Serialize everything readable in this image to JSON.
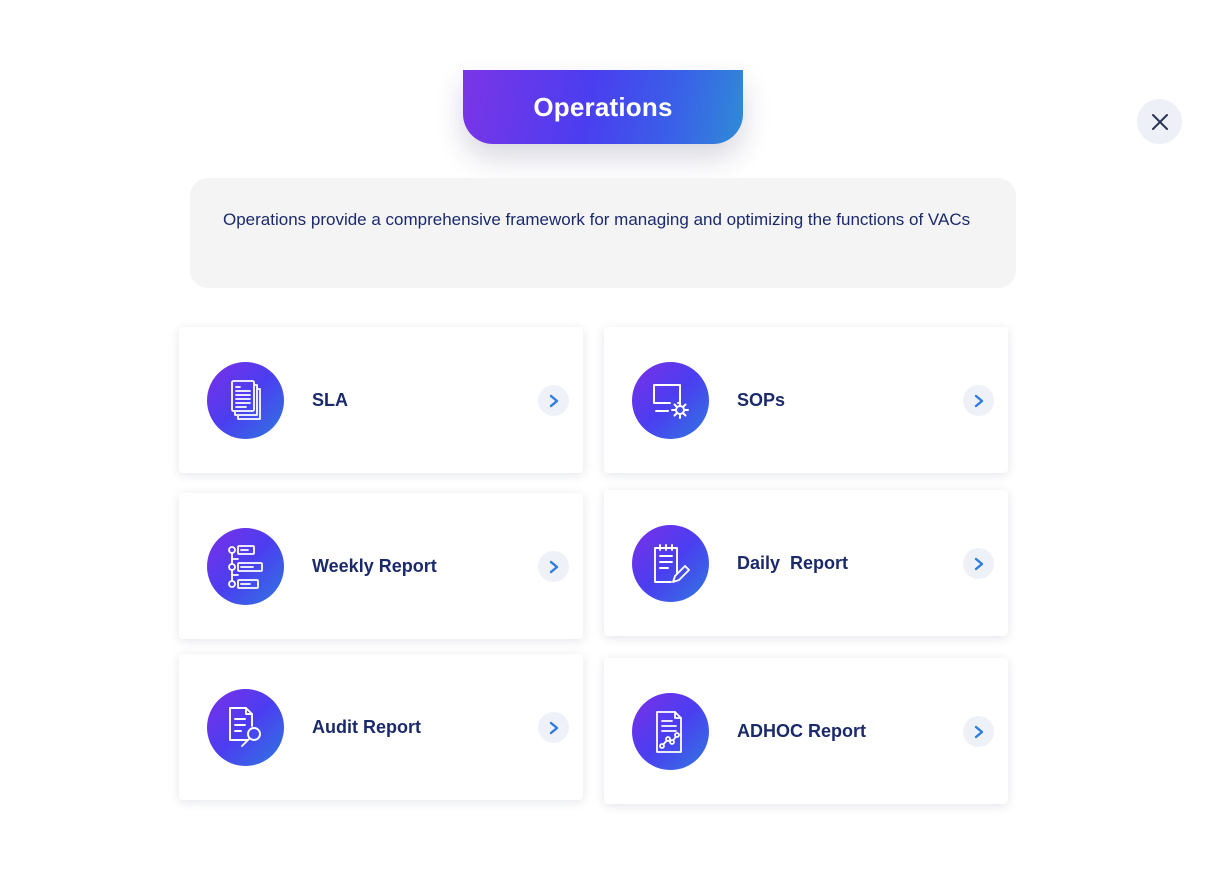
{
  "header": {
    "title": "Operations"
  },
  "description": "Operations provide a comprehensive framework for managing and optimizing the functions of VACs",
  "colors": {
    "accent_start": "#7b35e6",
    "accent_end": "#2f8bd6",
    "text": "#1b2a6b"
  },
  "cards": [
    {
      "label": "SLA",
      "icon": "documents-stack-icon"
    },
    {
      "label": "SOPs",
      "icon": "monitor-gear-icon"
    },
    {
      "label": "Weekly Report",
      "icon": "timeline-list-icon"
    },
    {
      "label": "Daily  Report",
      "icon": "clipboard-edit-icon"
    },
    {
      "label": "Audit Report",
      "icon": "document-search-icon"
    },
    {
      "label": "ADHOC Report",
      "icon": "document-chart-icon"
    }
  ]
}
